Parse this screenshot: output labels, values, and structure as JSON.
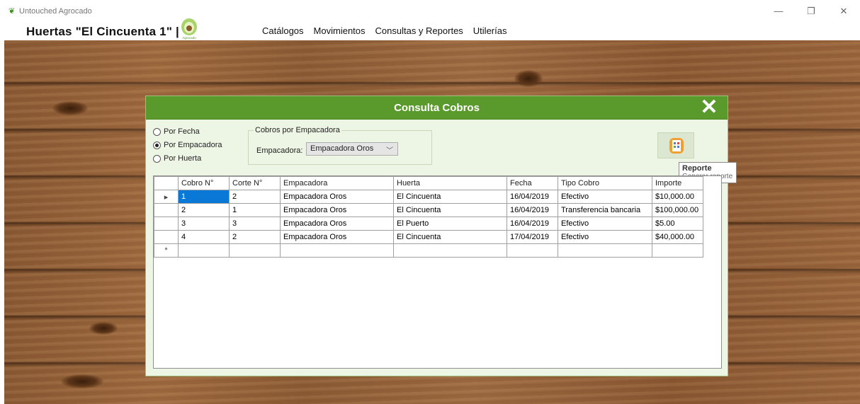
{
  "window": {
    "title": "Untouched Agrocado",
    "controls": {
      "minimize": "—",
      "maximize": "❐",
      "close": "✕"
    }
  },
  "header": {
    "company": "Huertas \"El Cincuenta 1\" |",
    "logo_text": "Agrocado",
    "menu": [
      "Catálogos",
      "Movimientos",
      "Consultas y Reportes",
      "Utilerías"
    ]
  },
  "dialog": {
    "title": "Consulta Cobros",
    "close": "✕",
    "filters": [
      {
        "label": "Por Fecha",
        "checked": false
      },
      {
        "label": "Por Empacadora",
        "checked": true
      },
      {
        "label": "Por Huerta",
        "checked": false
      }
    ],
    "group": {
      "legend": "Cobros por Empacadora",
      "label": "Empacadora:",
      "value": "Empacadora Oros"
    },
    "tooltip": {
      "title": "Reporte",
      "text": "Generar reporte"
    },
    "grid": {
      "columns": [
        "Cobro N°",
        "Corte N°",
        "Empacadora",
        "Huerta",
        "Fecha",
        "Tipo Cobro",
        "Importe"
      ],
      "rows": [
        [
          "1",
          "2",
          "Empacadora Oros",
          "El Cincuenta",
          "16/04/2019",
          "Efectivo",
          "$10,000.00"
        ],
        [
          "2",
          "1",
          "Empacadora Oros",
          "El Cincuenta",
          "16/04/2019",
          "Transferencia bancaria",
          "$100,000.00"
        ],
        [
          "3",
          "3",
          "Empacadora Oros",
          "El Puerto",
          "16/04/2019",
          "Efectivo",
          "$5.00"
        ],
        [
          "4",
          "2",
          "Empacadora Oros",
          "El Cincuenta",
          "17/04/2019",
          "Efectivo",
          "$40,000.00"
        ]
      ],
      "current_row_marker": "▸",
      "new_row_marker": "*"
    }
  },
  "colors": {
    "dialog_header": "#5a9a2c",
    "dialog_body": "#edf5e4",
    "selection": "#0a78d7"
  }
}
